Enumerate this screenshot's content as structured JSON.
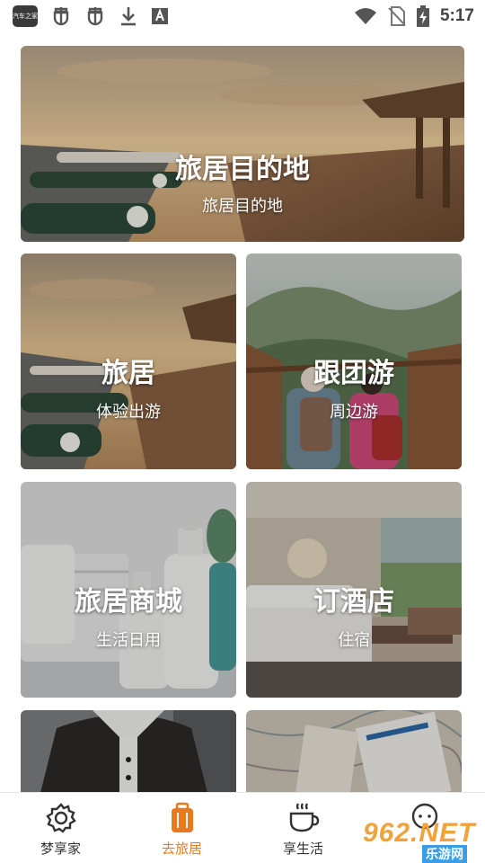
{
  "status_bar": {
    "app_chip_label": "汽车之家",
    "left_icons": [
      "bug-icon",
      "bug-icon",
      "download-icon",
      "font-icon"
    ],
    "right_icons": [
      "wifi-icon",
      "no-sim-icon",
      "battery-charging-icon"
    ],
    "time": "5:17"
  },
  "cards": {
    "hero": {
      "title": "旅居目的地",
      "subtitle": "旅居目的地"
    },
    "c1": {
      "title": "旅居",
      "subtitle": "体验出游"
    },
    "c2": {
      "title": "跟团游",
      "subtitle": "周边游"
    },
    "c3": {
      "title": "旅居商城",
      "subtitle": "生活日用"
    },
    "c4": {
      "title": "订酒店",
      "subtitle": "住宿"
    }
  },
  "bottom_nav": {
    "items": [
      {
        "label": "梦享家",
        "icon": "gear-icon",
        "active": false
      },
      {
        "label": "去旅居",
        "icon": "suitcase-icon",
        "active": true
      },
      {
        "label": "享生活",
        "icon": "coffee-cup-icon",
        "active": false
      },
      {
        "label": "",
        "icon": "chat-icon",
        "active": false
      }
    ]
  },
  "watermark": {
    "brand": "962.NET",
    "sub": "乐游网"
  },
  "colors": {
    "accent": "#e8791d",
    "nav_text": "#333333"
  }
}
